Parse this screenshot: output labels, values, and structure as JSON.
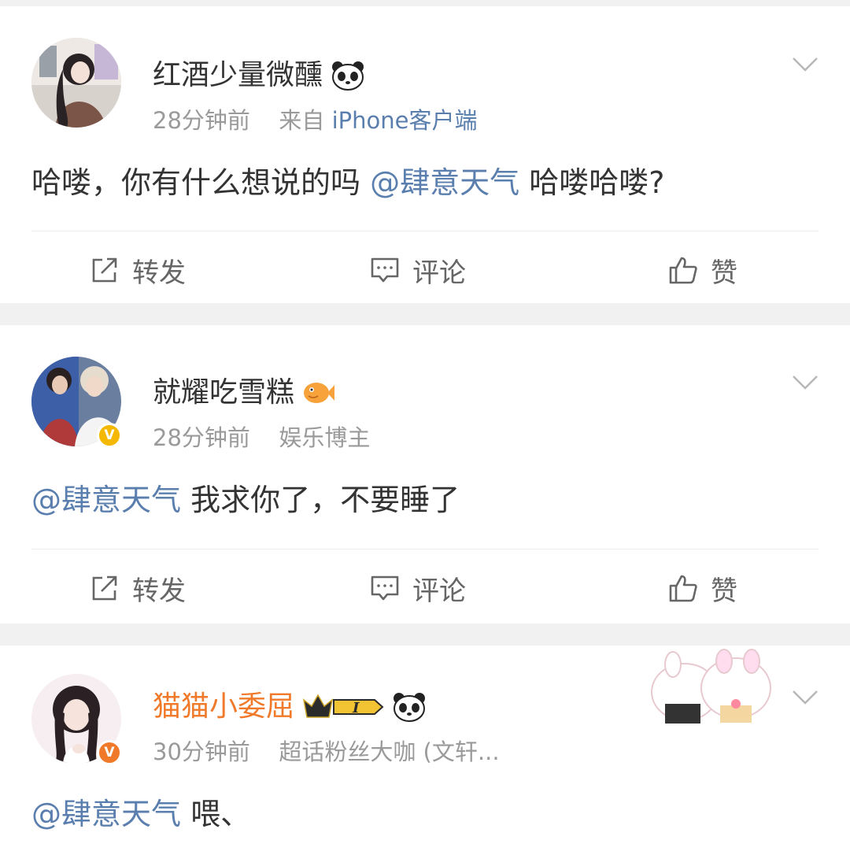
{
  "posts": [
    {
      "username": "红酒少量微醺",
      "time": "28分钟前",
      "meta_prefix": "来自",
      "meta_link": "iPhone客户端",
      "content": [
        {
          "text": "哈喽，你有什么想说的吗 ",
          "mention": false
        },
        {
          "text": "@肆意天气",
          "mention": true
        },
        {
          "text": " 哈喽哈喽?",
          "mention": false
        }
      ],
      "badges": [
        "panda-icon"
      ]
    },
    {
      "username": "就耀吃雪糕",
      "time": "28分钟前",
      "meta_prefix": "娱乐博主",
      "content": [
        {
          "text": "@肆意天气",
          "mention": true
        },
        {
          "text": " 我求你了，不要睡了",
          "mention": false
        }
      ],
      "badges": [
        "fish-icon"
      ],
      "verified_color": "#f5b800"
    },
    {
      "username": "猫猫小委屈",
      "time": "30分钟前",
      "meta_prefix": "超话粉丝大咖 (文轩...",
      "content": [
        {
          "text": "@肆意天气",
          "mention": true
        },
        {
          "text": " 喂、",
          "mention": false
        }
      ],
      "badges": [
        "crown-level-icon",
        "panda-icon"
      ],
      "level_text": "I",
      "verified_color": "#f07a2a",
      "username_color": "#f07a2a"
    }
  ],
  "actions": {
    "repost": "转发",
    "comment": "评论",
    "like": "赞"
  },
  "colors": {
    "mention": "#5a7fae",
    "meta": "#9a9a9a",
    "text": "#333333"
  }
}
